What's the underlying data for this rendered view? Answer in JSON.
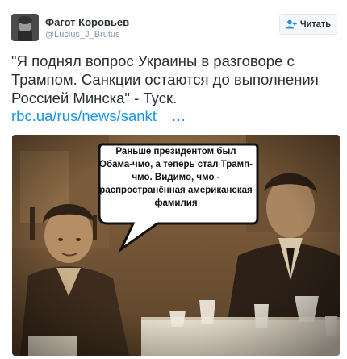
{
  "author": {
    "name": "Фагот Коровьев",
    "handle": "@Lucius_J_Brutus"
  },
  "follow_button": {
    "label": "Читать",
    "icon": "add-user-icon",
    "color": "#292f33"
  },
  "tweet": {
    "text": "\"Я поднял вопрос Украины в разговоре с Трампом. Санкции остаются до выполнения Россией Минска\" - Туск.",
    "link_text": "rbc.ua/rus/news/sankt",
    "link_ellipsis": "…",
    "link_color": "#1b95e0"
  },
  "media": {
    "speech_bubble_text": "Раньше президентом был Обама-чмо, а теперь стал Трамп-чмо. Видимо, чмо - распространённая американская фамилия"
  }
}
